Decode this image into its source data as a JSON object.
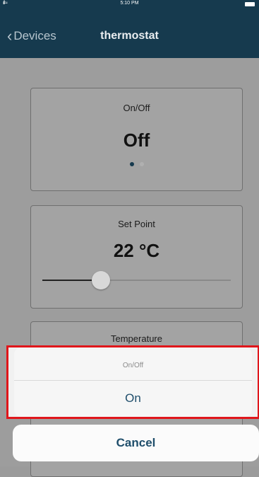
{
  "status_bar": {
    "time": "5:10 PM",
    "signal": "ıll ≈"
  },
  "nav": {
    "back_label": "Devices",
    "title": "thermostat"
  },
  "cards": {
    "onoff": {
      "label": "On/Off",
      "value": "Off"
    },
    "setpoint": {
      "label": "Set Point",
      "value": "22 °C",
      "slider_fraction": 0.31
    },
    "temperature": {
      "label": "Temperature"
    }
  },
  "action_sheet": {
    "title": "On/Off",
    "option": "On",
    "cancel": "Cancel"
  },
  "colors": {
    "nav_bg": "#163a4e",
    "accent": "#1f4e6b",
    "highlight_border": "#e0161b"
  },
  "icons": {
    "back": "chevron-left-icon"
  }
}
